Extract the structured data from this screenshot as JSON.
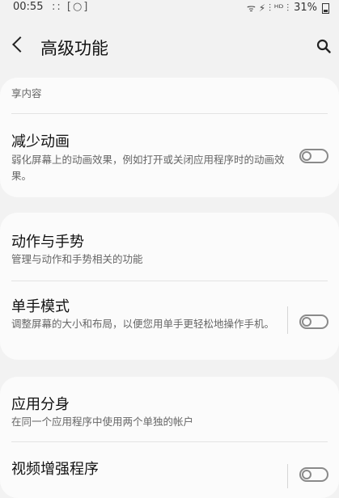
{
  "status_bar": {
    "time": "00:55",
    "left_icons": ":: [○]",
    "signal": "ᯤ ⚡ ⫶ ᴴᴰ ⫶",
    "battery_percent": "31%"
  },
  "header": {
    "title": "高级功能",
    "back_icon": "chevron-left-icon",
    "search_icon": "search-icon"
  },
  "items": [
    {
      "title": "",
      "desc": "享内容"
    },
    {
      "title": "减少动画",
      "desc": "弱化屏幕上的动画效果，例如打开或关闭应用程序时的动画效果。",
      "toggle": false
    },
    {
      "title": "动作与手势",
      "desc": "管理与动作和手势相关的功能"
    },
    {
      "title": "单手模式",
      "desc": "调整屏幕的大小和布局，以便您用单手更轻松地操作手机。",
      "toggle": false
    },
    {
      "title": "应用分身",
      "desc": "在同一个应用程序中使用两个单独的帐户"
    },
    {
      "title": "视频增强程序",
      "desc": "",
      "toggle": false
    }
  ]
}
